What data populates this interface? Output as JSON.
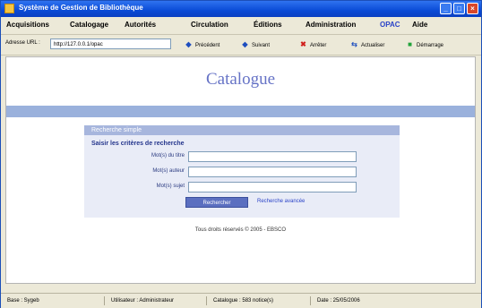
{
  "window": {
    "title": "Système de Gestion de Bibliothèque",
    "controls": [
      "_",
      "□",
      "×"
    ]
  },
  "menu": [
    {
      "label": "Acquisitions"
    },
    {
      "label": "Catalogage"
    },
    {
      "label": "Autorités"
    },
    {
      "label": "Circulation"
    },
    {
      "label": "Éditions"
    },
    {
      "label": "Administration"
    },
    {
      "label": "OPAC",
      "active": true
    },
    {
      "label": "Aide"
    }
  ],
  "toolbar": {
    "address_label": "Adresse URL :",
    "address_value": "http://127.0.0.1/opac",
    "buttons": [
      {
        "label": "Précédent",
        "icon": "arrow-left-icon",
        "glyph": "◆",
        "color": "#1f4fbf"
      },
      {
        "label": "Suivant",
        "icon": "arrow-right-icon",
        "glyph": "◆",
        "color": "#1f4fbf"
      },
      {
        "label": "Arrêter",
        "icon": "stop-icon",
        "glyph": "✖",
        "color": "#d0201c"
      },
      {
        "label": "Actualiser",
        "icon": "refresh-icon",
        "glyph": "⇆",
        "color": "#1f4fbf"
      },
      {
        "label": "Démarrage",
        "icon": "home-icon",
        "glyph": "■",
        "color": "#21a33a"
      }
    ]
  },
  "page": {
    "heading": "Catalogue",
    "panel_title": "Recherche simple",
    "panel_subtitle": "Saisir les critères de recherche",
    "fields": [
      {
        "label": "Mot(s) du titre",
        "value": ""
      },
      {
        "label": "Mot(s) auteur",
        "value": ""
      },
      {
        "label": "Mot(s) sujet",
        "value": ""
      }
    ],
    "search_button": "Rechercher",
    "advanced_link": "Recherche avancée",
    "footer": "Tous droits réservés © 2005 - EBSCO"
  },
  "status": [
    {
      "label": "Base : Sygeb"
    },
    {
      "label": "Utilisateur : Administrateur"
    },
    {
      "label": "Catalogue : 583 notice(s)"
    },
    {
      "label": "Date : 25/05/2006"
    }
  ],
  "colors": {
    "titlebar": "#0a4bd6",
    "accent": "#6673c6",
    "panel": "#e9ecf7",
    "header_band": "#9ab1dc"
  }
}
